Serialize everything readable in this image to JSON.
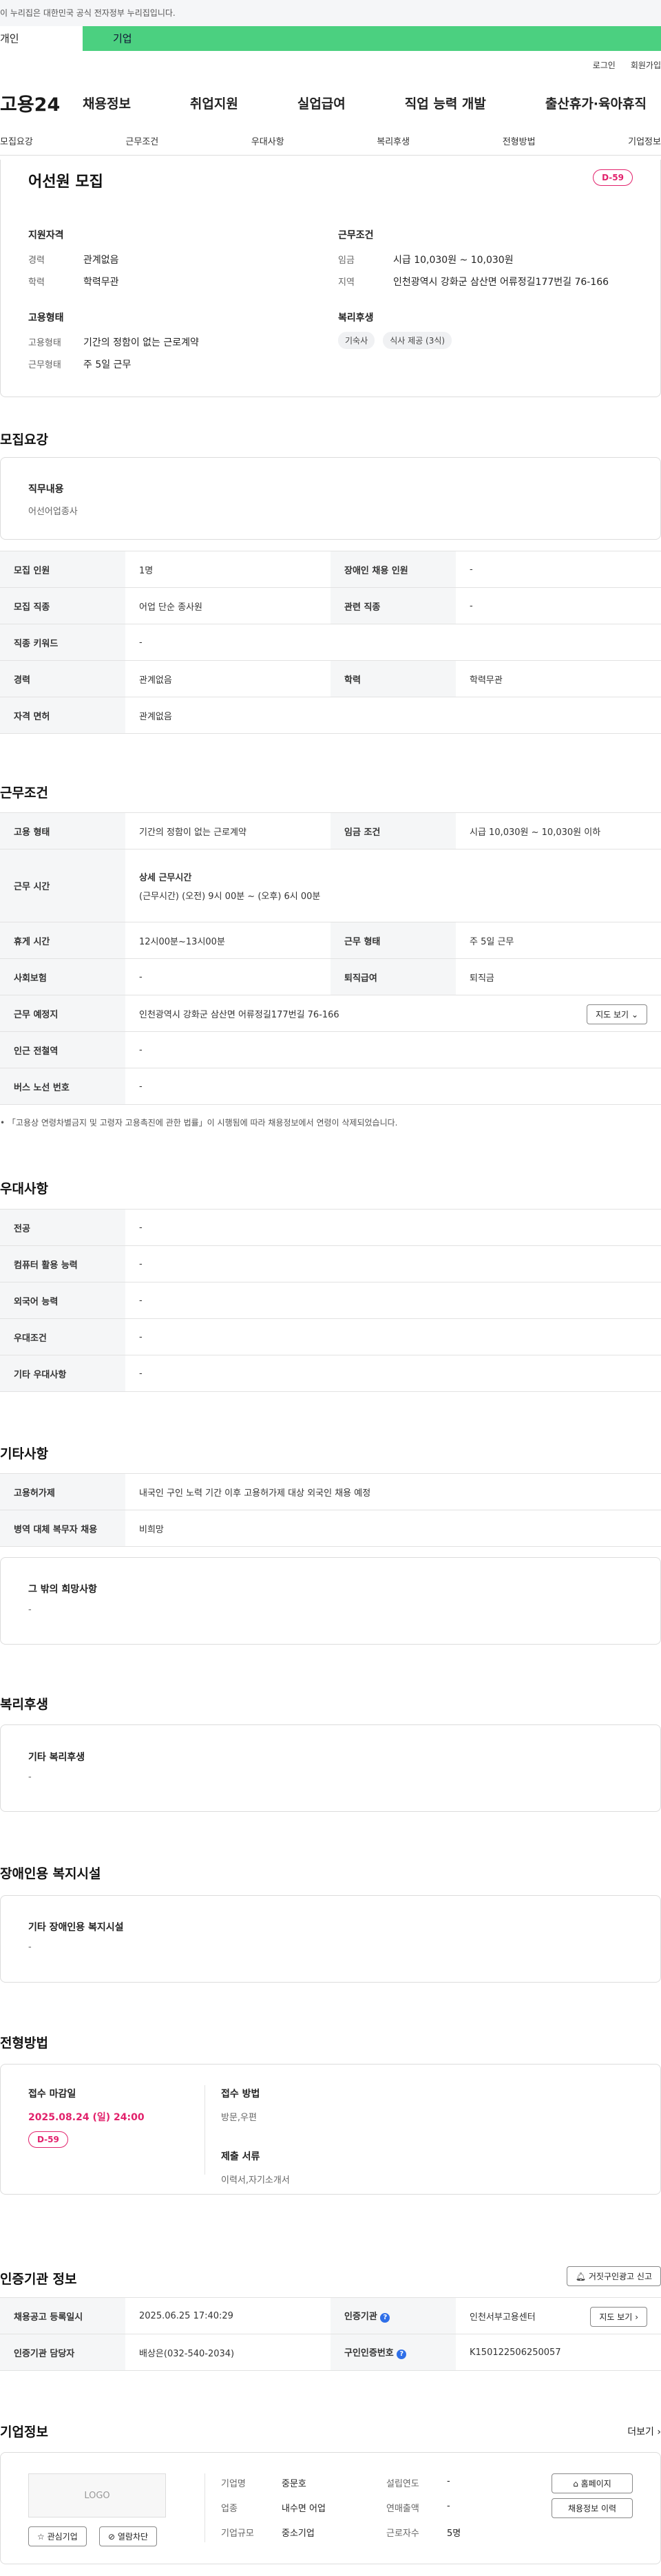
{
  "top": {
    "gov_notice": "이 누리집은 대한민국 공식 전자정부 누리집입니다.",
    "tab_individual": "개인",
    "tab_company": "기업",
    "util_login": "로그인",
    "util_join": "회원가입",
    "logo": "고용24",
    "gnb": [
      "채용정보",
      "취업지원",
      "실업급여",
      "직업 능력 개발",
      "출산휴가·육아휴직"
    ],
    "lnb": [
      "모집요강",
      "근무조건",
      "우대사항",
      "복리후생",
      "전형방법",
      "기업정보"
    ]
  },
  "summary": {
    "title": "어선원 모집",
    "dday": "D-59",
    "qual_title": "지원자격",
    "career_label": "경력",
    "career_value": "관계없음",
    "edu_label": "학력",
    "edu_value": "학력무관",
    "emp_title": "고용형태",
    "emptype_label": "고용형태",
    "emptype_value": "기간의 정함이 없는 근로계약",
    "worktype_label": "근무형태",
    "worktype_value": "주 5일 근무",
    "cond_title": "근무조건",
    "wage_label": "임금",
    "wage_value": "시급 10,030원 ~ 10,030원",
    "region_label": "지역",
    "region_value": "인천광역시 강화군 삼산면 어류정길177번길 76-166",
    "welfare_title": "복리후생",
    "tags": [
      "기숙사",
      "식사 제공 (3식)"
    ]
  },
  "recruit": {
    "title": "모집요강",
    "job_label": "직무내용",
    "job_value": "어선어업종사",
    "rows": {
      "headcount_label": "모집 인원",
      "headcount_value": "1명",
      "disabled_label": "장애인 채용 인원",
      "disabled_value": "-",
      "category_label": "모집 직종",
      "category_value": "어업 단순 종사원",
      "related_label": "관련 직종",
      "related_value": "-",
      "keyword_label": "직종 키워드",
      "keyword_value": "-",
      "career_label": "경력",
      "career_value": "관계없음",
      "edu_label": "학력",
      "edu_value": "학력무관",
      "license_label": "자격 면허",
      "license_value": "관계없음"
    }
  },
  "conditions": {
    "title": "근무조건",
    "emptype_label": "고용 형태",
    "emptype_value": "기간의 정함이 없는 근로계약",
    "wagecond_label": "임금 조건",
    "wagecond_value": "시급 10,030원 ~ 10,030원 이하",
    "worktime_label": "근무 시간",
    "worktime_sub": "상세 근무시간",
    "worktime_value": "(근무시간) (오전) 9시 00분 ~ (오후) 6시 00분",
    "rest_label": "휴게 시간",
    "rest_value": "12시00분~13시00분",
    "workform_label": "근무 형태",
    "workform_value": "주 5일 근무",
    "insurance_label": "사회보험",
    "insurance_value": "-",
    "severance_label": "퇴직급여",
    "severance_value": "퇴직금",
    "place_label": "근무 예정지",
    "place_value": "인천광역시 강화군 삼산면 어류정길177번길 76-166",
    "map_button": "지도 보기",
    "station_label": "인근 전철역",
    "station_value": "-",
    "bus_label": "버스 노선 번호",
    "bus_value": "-",
    "note": "「고용상 연령차별금지 및 고령자 고용촉진에 관한 법률」이 시행됨에 따라 채용정보에서 연령이 삭제되었습니다."
  },
  "preference": {
    "title": "우대사항",
    "major_label": "전공",
    "major_value": "-",
    "computer_label": "컴퓨터 활용 능력",
    "computer_value": "-",
    "language_label": "외국어 능력",
    "language_value": "-",
    "cond_label": "우대조건",
    "cond_value": "-",
    "etc_label": "기타 우대사항",
    "etc_value": "-"
  },
  "other": {
    "title": "기타사항",
    "permit_label": "고용허가제",
    "permit_value": "내국인 구인 노력 기간 이후 고용허가제 대상 외국인 채용 예정",
    "military_label": "병역 대체 복무자 채용",
    "military_value": "비희망",
    "hope_label": "그 밖의 희망사항",
    "hope_value": "-"
  },
  "welfare": {
    "title": "복리후생",
    "label": "기타 복리후생",
    "value": "-"
  },
  "disability": {
    "title": "장애인용 복지시설",
    "label": "기타 장애인용 복지시설",
    "value": "-"
  },
  "process": {
    "title": "전형방법",
    "deadline_label": "접수 마감일",
    "deadline_value": "2025.08.24 (일) 24:00",
    "dday": "D-59",
    "method_label": "접수 방법",
    "method_value": "방문,우편",
    "docs_label": "제출 서류",
    "docs_value": "이력서,자기소개서"
  },
  "cert": {
    "title": "인증기관 정보",
    "report_button": "거짓구인광고 신고",
    "reg_label": "채용공고 등록일시",
    "reg_value": "2025.06.25 17:40:29",
    "agency_label": "인증기관",
    "agency_value": "인천서부고용센터",
    "map_button": "지도 보기",
    "manager_label": "인증기관 담당자",
    "manager_value": "배상은(032-540-2034)",
    "authno_label": "구인인증번호",
    "authno_value": "K150122506250057"
  },
  "company": {
    "title": "기업정보",
    "more": "더보기",
    "logo": "LOGO",
    "fav_button": "관심기업",
    "block_button": "열람차단",
    "name_label": "기업명",
    "name_value": "중문호",
    "industry_label": "업종",
    "industry_value": "내수면 어업",
    "size_label": "기업규모",
    "size_value": "중소기업",
    "founded_label": "설립연도",
    "founded_value": "-",
    "sales_label": "연매출액",
    "sales_value": "-",
    "staff_label": "근로자수",
    "staff_value": "5명",
    "homepage_button": "홈페이지",
    "jobs_button": "채용정보 이력"
  }
}
